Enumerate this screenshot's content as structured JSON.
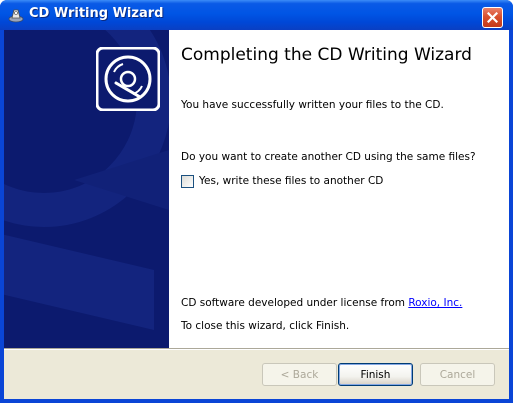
{
  "window": {
    "title": "CD Writing Wizard",
    "title_icon": "cd-burner-icon",
    "close_icon": "close-icon"
  },
  "colors": {
    "titlebar": "#0055e5",
    "banner": "#0c1a6e",
    "close_button": "#d9502e",
    "link": "#0000ff"
  },
  "banner": {
    "icon": "cd-icon"
  },
  "content": {
    "heading": "Completing the CD Writing Wizard",
    "success_text": "You have successfully written your files to the CD.",
    "question_text": "Do you want to create another CD using the same files?",
    "checkbox_label": "Yes, write these files to another CD",
    "checkbox_checked": false,
    "license_prefix": "CD software developed under license from ",
    "license_link": "Roxio, Inc.",
    "close_hint": "To close this wizard, click Finish."
  },
  "buttons": {
    "back": "< Back",
    "finish": "Finish",
    "cancel": "Cancel"
  }
}
